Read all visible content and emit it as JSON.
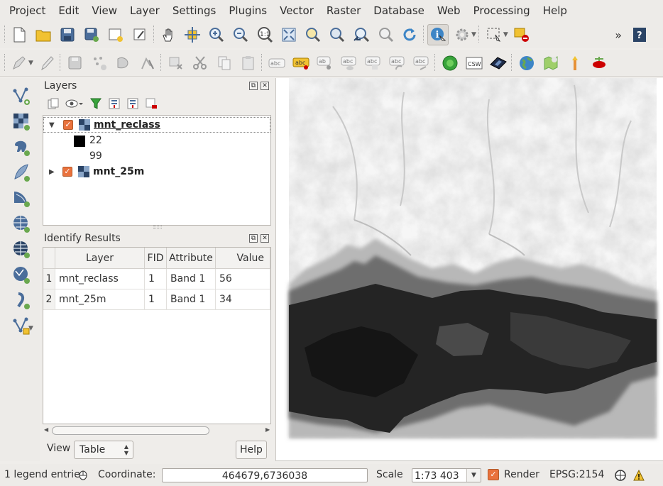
{
  "menubar": {
    "items": [
      "Project",
      "Edit",
      "View",
      "Layer",
      "Settings",
      "Plugins",
      "Vector",
      "Raster",
      "Database",
      "Web",
      "Processing",
      "Help"
    ]
  },
  "toolbar": {
    "overflow_label": "»"
  },
  "layers_panel": {
    "title": "Layers",
    "items": [
      {
        "name": "mnt_reclass",
        "checked": true,
        "expanded": true,
        "legend": [
          {
            "label": "22",
            "color": "#000000"
          },
          {
            "label": "99",
            "color": "#ffffff"
          }
        ]
      },
      {
        "name": "mnt_25m",
        "checked": true,
        "expanded": false
      }
    ]
  },
  "identify_panel": {
    "title": "Identify Results",
    "columns": [
      "Layer",
      "FID",
      "Attribute",
      "Value"
    ],
    "rows": [
      {
        "num": "1",
        "layer": "mnt_reclass",
        "fid": "1",
        "attribute": "Band 1",
        "value": "56"
      },
      {
        "num": "2",
        "layer": "mnt_25m",
        "fid": "1",
        "attribute": "Band 1",
        "value": "34"
      }
    ],
    "view_label": "View",
    "view_value": "Table",
    "help_label": "Help"
  },
  "statusbar": {
    "legend_text": "1 legend entrie",
    "coordinate_label": "Coordinate:",
    "coordinate_value": "464679,6736038",
    "scale_label": "Scale",
    "scale_value": "1:73 403",
    "render_label": "Render",
    "crs_label": "EPSG:2154"
  },
  "colors": {
    "accent": "#e9723d",
    "map_dark": "#1c1c1c",
    "map_light": "#f7f7f7"
  }
}
